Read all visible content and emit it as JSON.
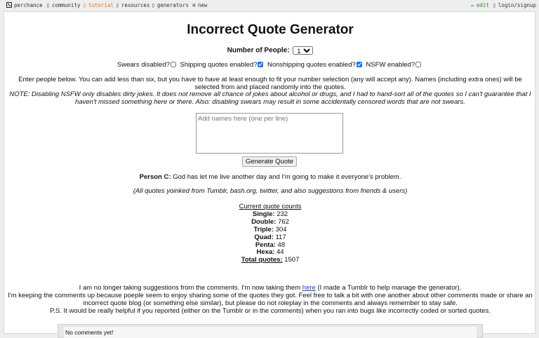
{
  "nav": {
    "brand": "perchance",
    "community": "community",
    "tutorial": "tutorial",
    "resources": "resources",
    "generators": "generators",
    "new": "new",
    "edit": "edit",
    "login": "login/signup",
    "tutorial_color": "#e07a16",
    "edit_color": "#2a8a2a"
  },
  "page": {
    "title": "Incorrect Quote Generator",
    "people_label": "Number of People:",
    "people_value": "1",
    "opt_swears": "Swears disabled?",
    "opt_shipping": "Shipping quotes enabled?",
    "opt_nonshipping": "Nonshipping quotes enabled?",
    "opt_nsfw": "NSFW enabled?",
    "intro": "Enter people below. You can add less than six, but you have to have at least enough to fit your number selection (any will accept any). Names (including extra ones) will be selected from and placed randomly into the quotes.",
    "note": "NOTE: Disabling NSFW only disables dirty jokes. It does not remove all chance of jokes about alcohol or drugs, and I had to hand-sort all of the quotes so I can't guarantee that I haven't missed something here or there. Also: disabling swears may result in some accidentally censored words that are not swears.",
    "names_placeholder": "Add names here (one per line)",
    "generate_label": "Generate Quote",
    "quote_speaker": "Person C:",
    "quote_text": " God has let me live another day and I'm going to make it everyone's problem.",
    "sources": "(All quotes yoinked from Tumblr, bash.org, twitter, and also suggestions from friends & users)",
    "counts_title": "Current quote counts",
    "counts": [
      {
        "label": "Single:",
        "value": "232"
      },
      {
        "label": "Double:",
        "value": "762"
      },
      {
        "label": "Triple:",
        "value": "304"
      },
      {
        "label": "Quad:",
        "value": "117"
      },
      {
        "label": "Penta:",
        "value": "48"
      },
      {
        "label": "Hexa:",
        "value": "44"
      }
    ],
    "total_label": "Total quotes:",
    "total_value": "1507",
    "footer_pre": "I am no longer taking suggestions from the comments. I'm now taking them ",
    "footer_link": "here",
    "footer_post": " (I made a Tumblr to help manage the generator).",
    "footer2": "I'm keeping the comments up because poeple seem to enjoy sharing some of the quotes they got. Feel free to talk a bit with one another about other comments made or share an incorrect quote blog (or something else similar), but please do not roleplay in the comments and always remember to stay safe.",
    "footer3": "P.S. It would be really helpful if you reported (either on the Tumblr or in the comments) when you ran into bugs like incorrectly coded or sorted quotes.",
    "no_comments": "No comments yet!"
  }
}
